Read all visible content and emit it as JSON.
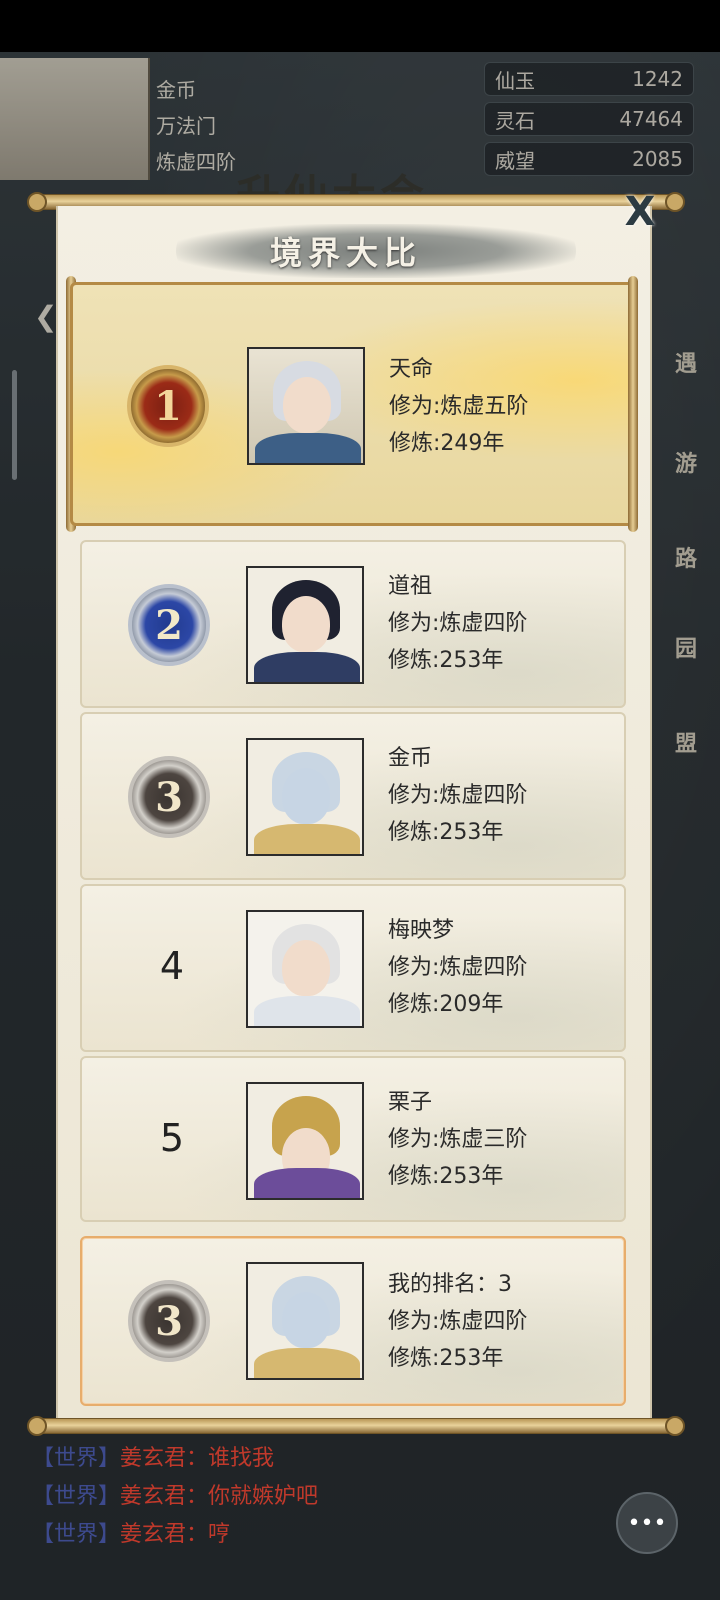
{
  "player": {
    "name": "金币",
    "sect": "万法门",
    "realm": "炼虚四阶"
  },
  "currencies": [
    {
      "name": "仙玉",
      "value": "1242"
    },
    {
      "name": "灵石",
      "value": "47464"
    },
    {
      "name": "威望",
      "value": "2085"
    }
  ],
  "background_title": "升仙大会",
  "side_buttons": [
    "遇",
    "游",
    "路",
    "园",
    "盟"
  ],
  "dialog": {
    "title": "境界大比",
    "close_label": "X"
  },
  "rankings": [
    {
      "rank": "1",
      "name": "天命",
      "cultivation": "修为:炼虚五阶",
      "years": "修炼:249年"
    },
    {
      "rank": "2",
      "name": "道祖",
      "cultivation": "修为:炼虚四阶",
      "years": "修炼:253年"
    },
    {
      "rank": "3",
      "name": "金币",
      "cultivation": "修为:炼虚四阶",
      "years": "修炼:253年"
    },
    {
      "rank": "4",
      "name": "梅映梦",
      "cultivation": "修为:炼虚四阶",
      "years": "修炼:209年"
    },
    {
      "rank": "5",
      "name": "栗子",
      "cultivation": "修为:炼虚三阶",
      "years": "修炼:253年"
    }
  ],
  "my_rank": {
    "rank": "3",
    "label": "我的排名：3",
    "cultivation": "修为:炼虚四阶",
    "years": "修炼:253年"
  },
  "chat": [
    {
      "channel": "【世界】",
      "nick": "姜玄君：",
      "message": "谁找我"
    },
    {
      "channel": "【世界】",
      "nick": "姜玄君：",
      "message": "你就嫉妒吧"
    },
    {
      "channel": "【世界】",
      "nick": "姜玄君：",
      "message": "哼"
    }
  ],
  "colors": {
    "chat_name": "#c0392b",
    "chat_channel": "#3d4a8e",
    "highlight_border": "#e7ad6c"
  }
}
